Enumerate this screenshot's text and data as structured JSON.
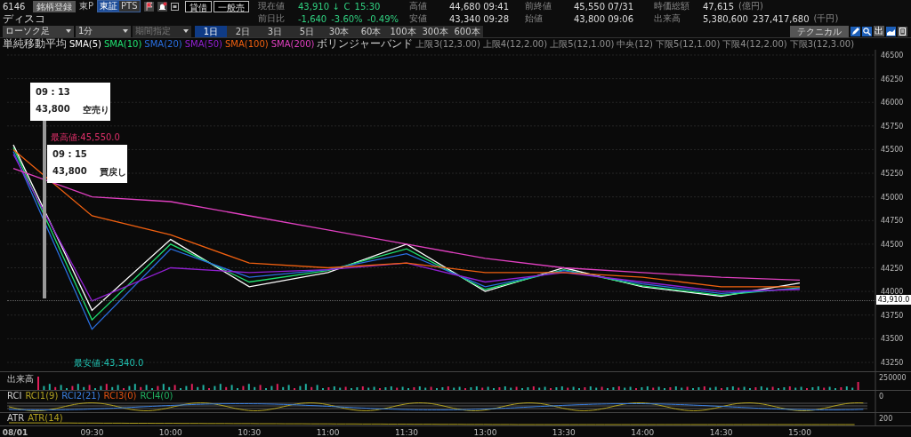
{
  "symbol": {
    "code": "6146",
    "name": "ディスコ",
    "register_button": "銘柄登録",
    "market": "東P",
    "exchanges": [
      {
        "label": "東証",
        "selected": true
      },
      {
        "label": "PTS",
        "selected": false
      }
    ]
  },
  "order_buttons": [
    "貸借",
    "一般売"
  ],
  "quotes": [
    {
      "label": "現在値",
      "kind": "live",
      "values": [
        "43,910 ↓",
        "C",
        "15:30"
      ]
    },
    {
      "label": "高値",
      "kind": "plain",
      "values": [
        "44,680 09:41"
      ]
    },
    {
      "label": "前終値",
      "kind": "plain",
      "values": [
        "45,550 07/31"
      ]
    },
    {
      "label": "時価総額",
      "kind": "plain",
      "values": [
        "47,615"
      ],
      "unit": "(億円)"
    },
    {
      "label": "前日比",
      "kind": "live",
      "values": [
        "-1,640",
        "-3.60%",
        "-0.49%"
      ]
    },
    {
      "label": "安値",
      "kind": "plain",
      "values": [
        "43,340 09:28"
      ]
    },
    {
      "label": "始値",
      "kind": "plain",
      "values": [
        "43,800 09:06"
      ]
    },
    {
      "label": "出来高",
      "kind": "plain",
      "values": [
        "5,380,600",
        "237,417,680"
      ],
      "unit": "(千円)"
    }
  ],
  "toolbar": {
    "chart_type": "ローソク足",
    "interval": "1分",
    "period": {
      "label": "期間指定",
      "disabled": true
    },
    "ranges": [
      {
        "label": "1日",
        "selected": true
      },
      {
        "label": "2日",
        "selected": false
      },
      {
        "label": "3日",
        "selected": false
      },
      {
        "label": "5日",
        "selected": false
      },
      {
        "label": "30本",
        "selected": false
      },
      {
        "label": "60本",
        "selected": false
      },
      {
        "label": "100本",
        "selected": false
      },
      {
        "label": "300本",
        "selected": false
      },
      {
        "label": "600本",
        "selected": false
      }
    ],
    "technical_button": "テクニカル",
    "volume_button": "出"
  },
  "legend": {
    "prefix": "単純移動平均",
    "bollinger": "ボリンジャーバンド",
    "bands": [
      "上限3(12,3.00)",
      "上限4(12,2.00)",
      "上限5(12,1.00)",
      "中央(12)",
      "下限5(12,1.00)",
      "下限4(12,2.00)",
      "下限3(12,3.00)"
    ]
  },
  "main_chart": {
    "high_label": "最高値:45,550.0",
    "low_label": "最安値:43,340.0",
    "last_price_label": "43,910.0",
    "chart_data": {
      "type": "line",
      "grid": true,
      "categories": [
        "08/01",
        "09:30",
        "10:00",
        "10:30",
        "11:00",
        "11:30",
        "13:00",
        "13:30",
        "14:00",
        "14:30",
        "15:00"
      ],
      "series": [
        {
          "name": "SMA(5)",
          "color": "#ffffff",
          "values": [
            45550,
            43800,
            44550,
            44050,
            44200,
            44500,
            44000,
            44250,
            44050,
            43950,
            44090
          ]
        },
        {
          "name": "SMA(10)",
          "color": "#20e070",
          "values": [
            45520,
            43700,
            44500,
            44100,
            44220,
            44450,
            44020,
            44230,
            44060,
            43960,
            44040
          ]
        },
        {
          "name": "SMA(20)",
          "color": "#2a6fe0",
          "values": [
            45480,
            43600,
            44450,
            44150,
            44230,
            44400,
            44050,
            44220,
            44080,
            43980,
            44030
          ]
        },
        {
          "name": "SMA(50)",
          "color": "#9020d0",
          "values": [
            45450,
            43900,
            44250,
            44200,
            44230,
            44300,
            44100,
            44200,
            44100,
            44000,
            44020
          ]
        },
        {
          "name": "SMA(100)",
          "color": "#f06010",
          "values": [
            45500,
            44800,
            44600,
            44300,
            44250,
            44300,
            44200,
            44200,
            44150,
            44050,
            44050
          ]
        },
        {
          "name": "SMA(200)",
          "color": "#e040c0",
          "values": [
            45300,
            45000,
            44950,
            44800,
            44650,
            44500,
            44350,
            44250,
            44200,
            44150,
            44120
          ]
        }
      ],
      "ylim": [
        43156,
        46556
      ],
      "yticks": [
        46500,
        46250,
        46000,
        45750,
        45500,
        45250,
        45000,
        44750,
        44500,
        44250,
        44000,
        43750,
        43500,
        43250
      ]
    }
  },
  "trades": [
    {
      "time": "09 : 13",
      "price": "43,800",
      "action": "空売り"
    },
    {
      "time": "09 : 15",
      "price": "43,800",
      "action": "買戻し"
    }
  ],
  "panels": {
    "volume": {
      "label": "出来高",
      "axis": "250000"
    },
    "rci": {
      "label": "RCI",
      "series": [
        {
          "label": "RCI1(9)",
          "color": "#b0a020"
        },
        {
          "label": "RCI2(21)",
          "color": "#3a7fe0"
        },
        {
          "label": "RCI3(0)",
          "color": "#e05010"
        },
        {
          "label": "RCI4(0)",
          "color": "#20b060"
        }
      ],
      "axis": "0"
    },
    "atr": {
      "label": "ATR",
      "series": [
        {
          "label": "ATR(14)",
          "color": "#b0a020"
        }
      ],
      "axis": "200"
    }
  }
}
